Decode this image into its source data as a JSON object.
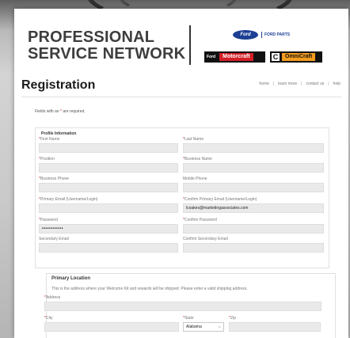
{
  "header": {
    "brand_line1": "PROFESSIONAL",
    "brand_line2": "SERVICE NETWORK",
    "ford_logo_text": "Ford",
    "ford_parts_text": "FORD PARTS",
    "motorcraft_small": "Ford",
    "motorcraft_text": "Motorcraft",
    "omni_c": "C",
    "omni_text": "OmniCraft"
  },
  "page": {
    "title": "Registration",
    "nav": [
      "home",
      "learn more",
      "contact us",
      "help"
    ],
    "nav_sep": "|"
  },
  "required_note": {
    "prefix": "Fields with an",
    "star": "*",
    "suffix": "are required."
  },
  "profile": {
    "legend": "Profile Information",
    "fields": [
      {
        "label": "First Name",
        "required": true,
        "value": ""
      },
      {
        "label": "Last Name",
        "required": true,
        "value": ""
      },
      {
        "label": "Position",
        "required": true,
        "value": ""
      },
      {
        "label": "Business Name",
        "required": true,
        "value": ""
      },
      {
        "label": "Business Phone",
        "required": true,
        "value": ""
      },
      {
        "label": "Mobile Phone",
        "required": false,
        "value": ""
      },
      {
        "label": "Primary Email (Username/Login)",
        "required": true,
        "value": ""
      },
      {
        "label": "Confirm Primary Email (Username/Login)",
        "required": true,
        "value": "lcoakes@marketingassociates.com"
      },
      {
        "label": "Password",
        "required": true,
        "value": "••••••••••••"
      },
      {
        "label": "Confirm Password",
        "required": true,
        "value": ""
      },
      {
        "label": "Secondary Email",
        "required": false,
        "value": ""
      },
      {
        "label": "Confirm Secondary Email",
        "required": false,
        "value": ""
      }
    ]
  },
  "location": {
    "legend": "Primary Location",
    "description": "This is the address where your Welcome Kit and rewards will be shipped. Please enter a valid shipping address.",
    "address_label": "Address",
    "city_label": "City",
    "state_label": "State",
    "state_value": "Alabama",
    "zip_label": "Zip",
    "star": "*"
  },
  "colors": {
    "required_star": "#d9281f",
    "ford_blue": "#1c3f94",
    "motorcraft_red": "#d31f26",
    "omnicraft_orange": "#f39c1e"
  },
  "icons": {
    "select_chevron": "chevron-down-icon"
  }
}
